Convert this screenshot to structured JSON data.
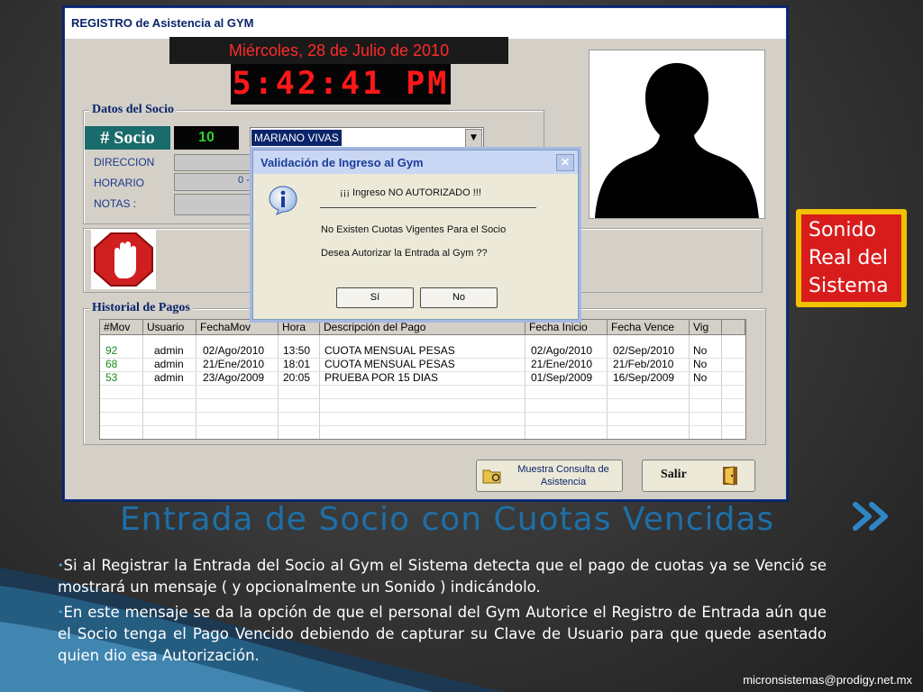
{
  "window": {
    "title": "REGISTRO  de Asistencia al GYM",
    "date": "Miércoles, 28 de Julio de 2010",
    "clock": "5:42:41 PM"
  },
  "socio": {
    "group_title": "Datos del Socio",
    "label": "# Socio",
    "number": "10",
    "name": "MARIANO VIVAS",
    "fields": {
      "direccion": "DIRECCION",
      "horario": "HORARIO",
      "horario_value": "0 -",
      "notas": "NOTAS :"
    }
  },
  "historial": {
    "title": "Historial de Pagos",
    "columns": [
      "#Mov",
      "Usuario",
      "FechaMov",
      "Hora",
      "Descripción del Pago",
      "Fecha Inicio",
      "Fecha Vence",
      "Vig"
    ],
    "rows": [
      [
        "92",
        "admin",
        "02/Ago/2010",
        "13:50",
        "CUOTA MENSUAL PESAS",
        "02/Ago/2010",
        "02/Sep/2010",
        "No"
      ],
      [
        "68",
        "admin",
        "21/Ene/2010",
        "18:01",
        "CUOTA MENSUAL PESAS",
        "21/Ene/2010",
        "21/Feb/2010",
        "No"
      ],
      [
        "53",
        "admin",
        "23/Ago/2009",
        "20:05",
        "PRUEBA POR 15 DIAS",
        "01/Sep/2009",
        "16/Sep/2009",
        "No"
      ]
    ]
  },
  "buttons": {
    "consulta": "Muestra Consulta de Asistencia",
    "salir": "Salir"
  },
  "dialog": {
    "title": "Validación de Ingreso al Gym",
    "heading": "¡¡¡  Ingreso NO AUTORIZADO  !!!",
    "line1": "No Existen Cuotas Vigentes Para el Socio",
    "line2": "Desea Autorizar la Entrada al Gym ??",
    "yes": "Sí",
    "no": "No"
  },
  "callout": {
    "line1": "Sonido",
    "line2": "Real del",
    "line3": "Sistema"
  },
  "slide": {
    "title": "Entrada de Socio con Cuotas Vencidas",
    "bullet1": "Si al Registrar la Entrada del Socio al Gym el Sistema detecta que el pago de cuotas ya se Venció se mostrará un mensaje ( y opcionalmente un Sonido ) indicándolo.",
    "bullet2": "En este mensaje se da la opción de que el personal del Gym Autorice el Registro de Entrada aún que el Socio tenga el Pago Vencido debiendo de capturar su Clave de Usuario para que quede asentado quien dio esa Autorización.",
    "footer": "micronsistemas@prodigy.net.mx"
  },
  "colors": {
    "title_blue": "#1e6fa8",
    "callout_red": "#d81c1c",
    "callout_border": "#f2c200",
    "clock_red": "#ff1818",
    "row_green": "#1a8a1a"
  }
}
